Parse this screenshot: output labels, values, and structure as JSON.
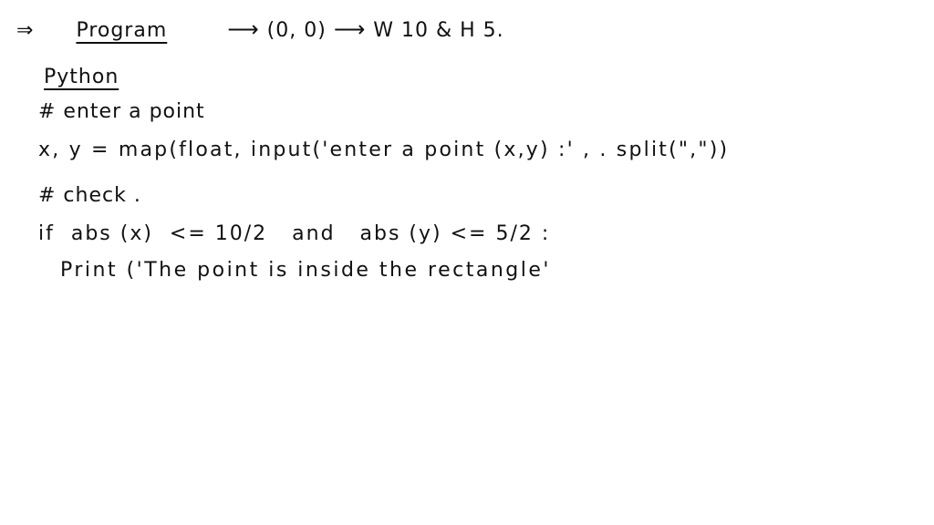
{
  "header_line": {
    "implies": "⇒",
    "title": "Program",
    "arrow1": "⟶",
    "origin": "(0, 0)",
    "arrow2": "⟶",
    "dimensions": "W 10 & H 5."
  },
  "language_heading": "Python",
  "code_lines": [
    "# enter a point",
    "x, y = map(float, input('enter a point (x,y) :' , . split(\",\"))",
    "# check .",
    "if  abs (x)  <= 10/2   and   abs (y) <= 5/2 :",
    "Print ('The point is inside the rectangle'"
  ]
}
